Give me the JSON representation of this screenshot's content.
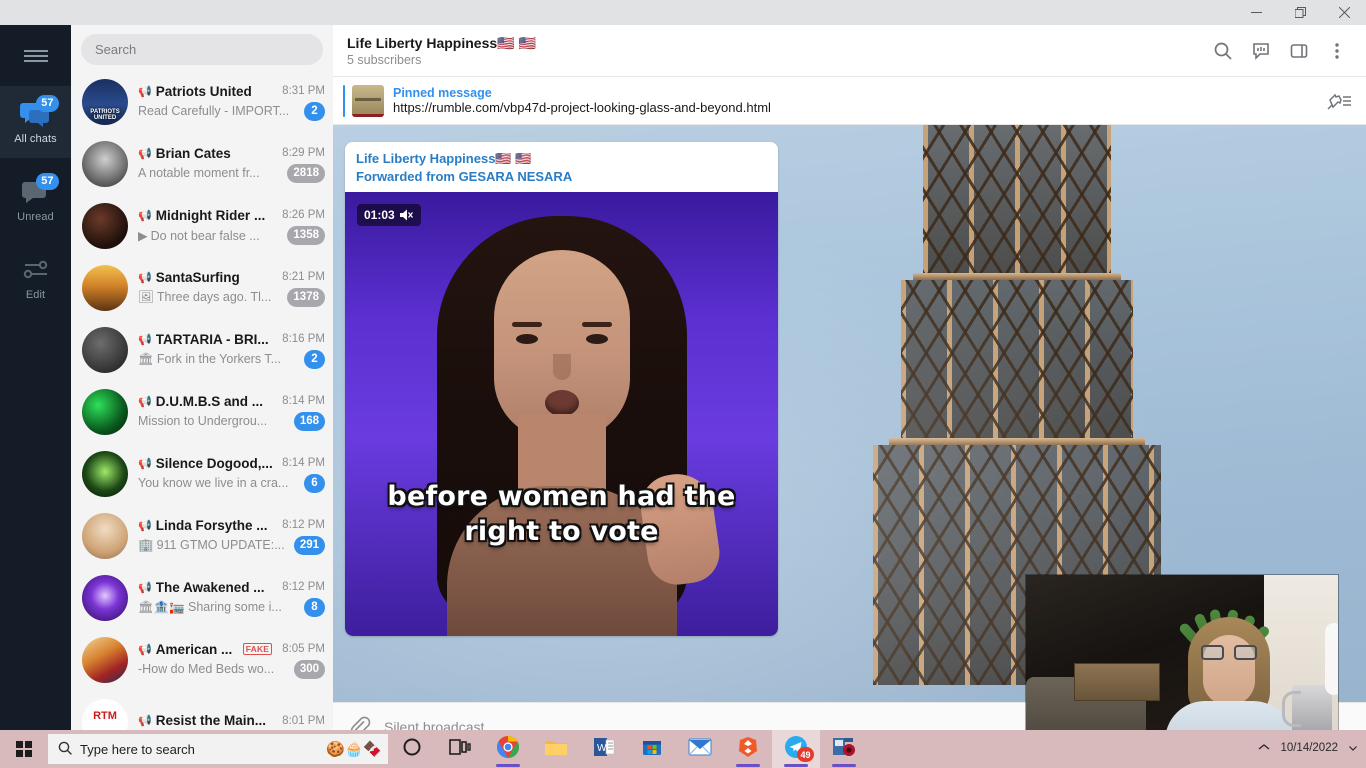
{
  "window": {
    "minimize_label": "—",
    "restore_label": "❐",
    "close_label": "✕"
  },
  "nav": {
    "menu_icon": "hamburger-icon",
    "items": [
      {
        "label": "All chats",
        "badge": "57",
        "icon": "chats-icon",
        "active": true
      },
      {
        "label": "Unread",
        "badge": "57",
        "icon": "unread-chat-icon",
        "active": false
      },
      {
        "label": "Edit",
        "badge": "",
        "icon": "sliders-icon",
        "active": false
      }
    ]
  },
  "search": {
    "placeholder": "Search"
  },
  "chats": [
    {
      "name": "Patriots United",
      "time": "8:31 PM",
      "preview": "Read Carefully - IMPORT...",
      "count": "2",
      "muted": false,
      "prefix_icon": "",
      "fake": false,
      "avatar_kind": "flag-patriots",
      "avatar_label": "PATRIOTS UNITED"
    },
    {
      "name": "Brian Cates",
      "time": "8:29 PM",
      "preview": "A notable moment fr...",
      "count": "2818",
      "muted": true,
      "prefix_icon": "",
      "fake": false,
      "avatar_kind": "portrait-cap",
      "avatar_label": ""
    },
    {
      "name": "Midnight Rider ...",
      "time": "8:26 PM",
      "preview": "Do not bear false ...",
      "count": "1358",
      "muted": true,
      "prefix_icon": "▶",
      "fake": false,
      "avatar_kind": "rider",
      "avatar_label": ""
    },
    {
      "name": "SantaSurfing",
      "time": "8:21 PM",
      "preview": "Three days ago. Tl...",
      "count": "1378",
      "muted": true,
      "prefix_icon": "🖼",
      "fake": false,
      "avatar_kind": "sunset-surfer",
      "avatar_label": ""
    },
    {
      "name": "TARTARIA - BRI...",
      "time": "8:16 PM",
      "preview": "Fork in the Yorkers T...",
      "count": "2",
      "muted": false,
      "prefix_icon": "🏛",
      "fake": false,
      "avatar_kind": "coin",
      "avatar_label": ""
    },
    {
      "name": "D.U.M.B.S and ...",
      "time": "8:14 PM",
      "preview": "Mission to Undergrou...",
      "count": "168",
      "muted": false,
      "prefix_icon": "",
      "fake": false,
      "avatar_kind": "green-globe",
      "avatar_label": ""
    },
    {
      "name": "Silence Dogood,...",
      "time": "8:14 PM",
      "preview": "You know we live in a cra...",
      "count": "6",
      "muted": false,
      "prefix_icon": "",
      "fake": false,
      "avatar_kind": "fireworks",
      "avatar_label": ""
    },
    {
      "name": "Linda Forsythe ...",
      "time": "8:12 PM",
      "preview": "911 GTMO UPDATE:...",
      "count": "291",
      "muted": false,
      "prefix_icon": "🏢",
      "fake": false,
      "avatar_kind": "woman-blonde",
      "avatar_label": ""
    },
    {
      "name": "The Awakened ...",
      "time": "8:12 PM",
      "preview": "Sharing some i...",
      "count": "8",
      "muted": false,
      "prefix_icon": "🏛🏦🏣",
      "fake": false,
      "avatar_kind": "purple-orb",
      "avatar_label": ""
    },
    {
      "name": "American ...",
      "time": "8:05 PM",
      "preview": "-How do Med Beds wo...",
      "count": "300",
      "muted": true,
      "prefix_icon": "",
      "fake": true,
      "fake_label": "FAKE",
      "avatar_kind": "flag-eagle",
      "avatar_label": ""
    },
    {
      "name": "Resist the Main...",
      "time": "8:01 PM",
      "preview": "",
      "count": "",
      "muted": false,
      "prefix_icon": "",
      "fake": false,
      "avatar_kind": "rtm-red",
      "avatar_label": "RTM"
    }
  ],
  "chat_header": {
    "title": "Life Liberty Happiness🇺🇸 🇺🇸",
    "subtitle": "5 subscribers",
    "icons": [
      "search-icon",
      "mentions-icon",
      "sidebar-toggle-icon",
      "more-options-icon"
    ]
  },
  "pinned": {
    "label": "Pinned message",
    "url": "https://rumble.com/vbp47d-project-looking-glass-and-beyond.html",
    "right_icon": "unpin-list-icon"
  },
  "message": {
    "channel": "Life Liberty Happiness🇺🇸 🇺🇸",
    "forwarded_from": "Forwarded from GESARA NESARA",
    "video_duration": "01:03",
    "muted_icon": "speaker-muted-icon",
    "subtitle_line1": "before women had the",
    "subtitle_line2": "right to vote"
  },
  "composer": {
    "attach_icon": "paperclip-icon",
    "placeholder": "Silent broadcast..."
  },
  "taskbar": {
    "start_icon": "windows-start-icon",
    "search_placeholder": "Type here to search",
    "search_decor_icons": [
      "cookie-icon",
      "cupcake-icon",
      "chocolate-icon"
    ],
    "items": [
      {
        "name": "cortana-icon",
        "label": "O",
        "badge": "",
        "running": false,
        "active": false
      },
      {
        "name": "task-view-icon",
        "label": "",
        "badge": "",
        "running": false,
        "active": false
      },
      {
        "name": "chrome-icon",
        "label": "",
        "badge": "",
        "running": true,
        "active": false
      },
      {
        "name": "file-explorer-icon",
        "label": "",
        "badge": "",
        "running": false,
        "active": false
      },
      {
        "name": "word-icon",
        "label": "W",
        "badge": "",
        "running": false,
        "active": false
      },
      {
        "name": "microsoft-store-icon",
        "label": "",
        "badge": "",
        "running": false,
        "active": false
      },
      {
        "name": "mail-icon",
        "label": "",
        "badge": "",
        "running": false,
        "active": false
      },
      {
        "name": "brave-icon",
        "label": "",
        "badge": "",
        "running": true,
        "active": false
      },
      {
        "name": "telegram-icon",
        "label": "",
        "badge": "49",
        "running": true,
        "active": true
      },
      {
        "name": "media-recorder-icon",
        "label": "",
        "badge": "",
        "running": true,
        "active": false
      }
    ],
    "clock_date": "10/14/2022",
    "show_desktop_icon": "chevron-up-icon"
  },
  "colors": {
    "accent": "#3390ec",
    "nav_bg": "#131c27",
    "list_bg": "#f4f4f5",
    "taskbar_bg": "#d8b9bc",
    "link": "#2a7dc4"
  }
}
